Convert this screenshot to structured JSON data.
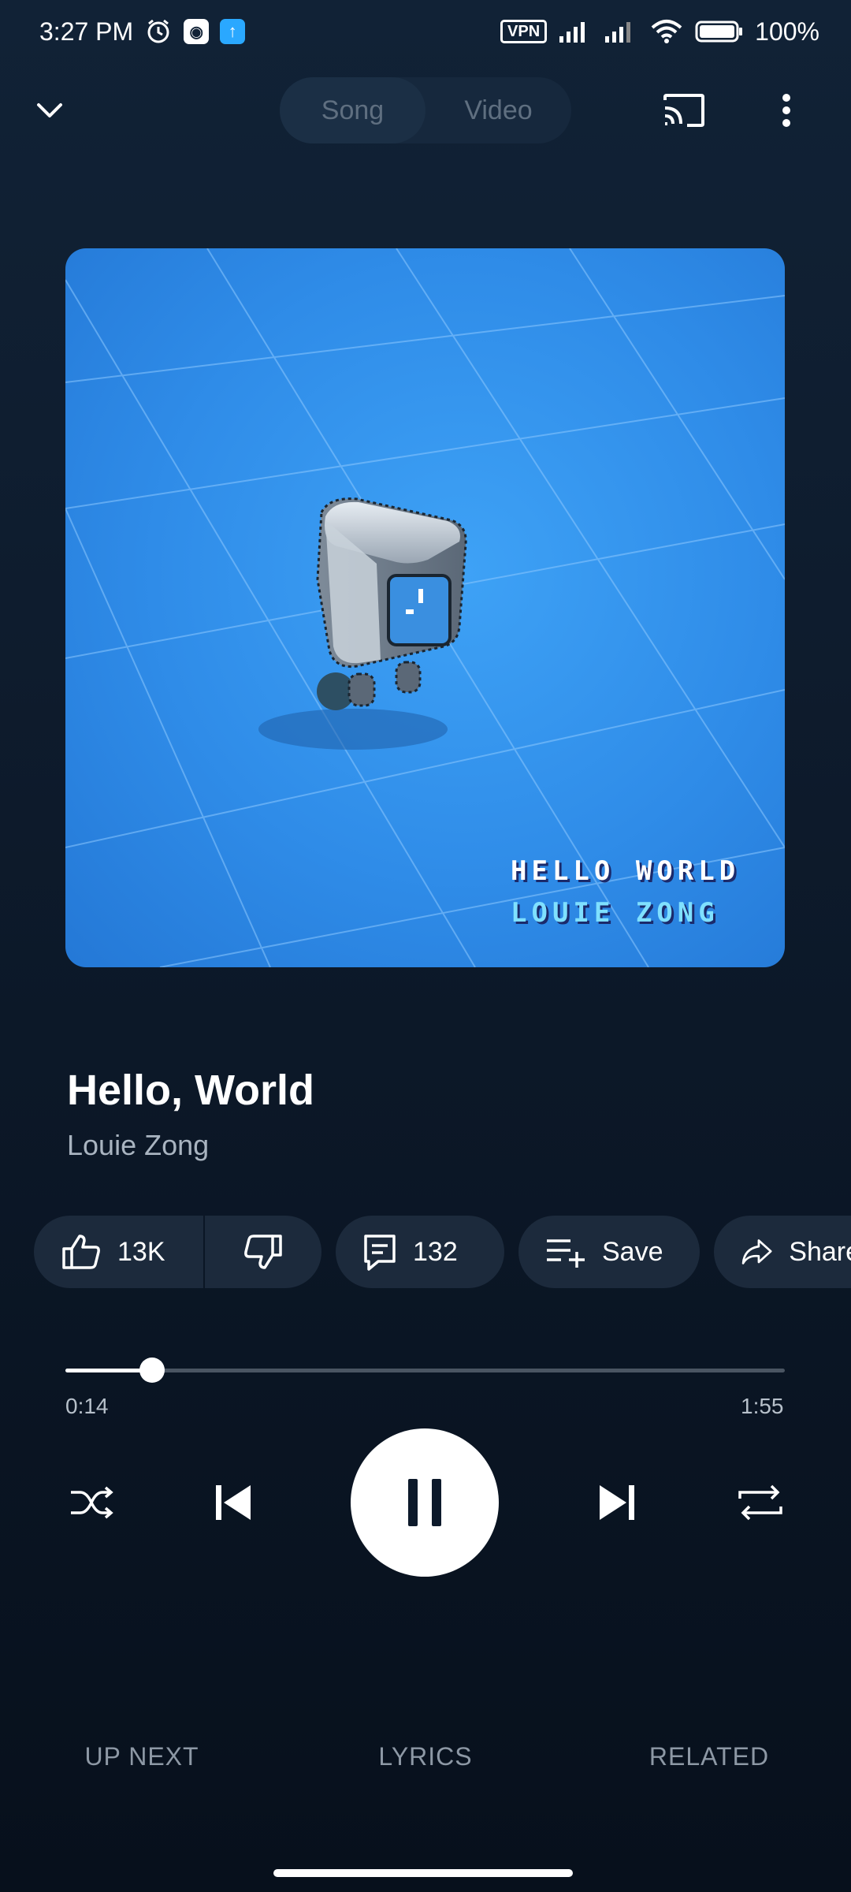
{
  "status_bar": {
    "time": "3:27 PM",
    "vpn": "VPN",
    "battery": "100%"
  },
  "toolbar": {
    "segment_song": "Song",
    "segment_video": "Video",
    "active_segment": "Song"
  },
  "artwork": {
    "line1": "HELLO WORLD",
    "line2": "LOUIE ZONG"
  },
  "track": {
    "title": "Hello, World",
    "artist": "Louie Zong"
  },
  "actions": {
    "likes": "13K",
    "comments": "132",
    "save_label": "Save",
    "share_label": "Share"
  },
  "playback": {
    "current_time": "0:14",
    "total_time": "1:55",
    "progress": 0.12,
    "state": "playing"
  },
  "tabs": {
    "up_next": "UP NEXT",
    "lyrics": "LYRICS",
    "related": "RELATED"
  },
  "colors": {
    "background": "#0d1a2b",
    "chip": "#1c2a3c",
    "artwork_blue": "#2f8ce8"
  }
}
